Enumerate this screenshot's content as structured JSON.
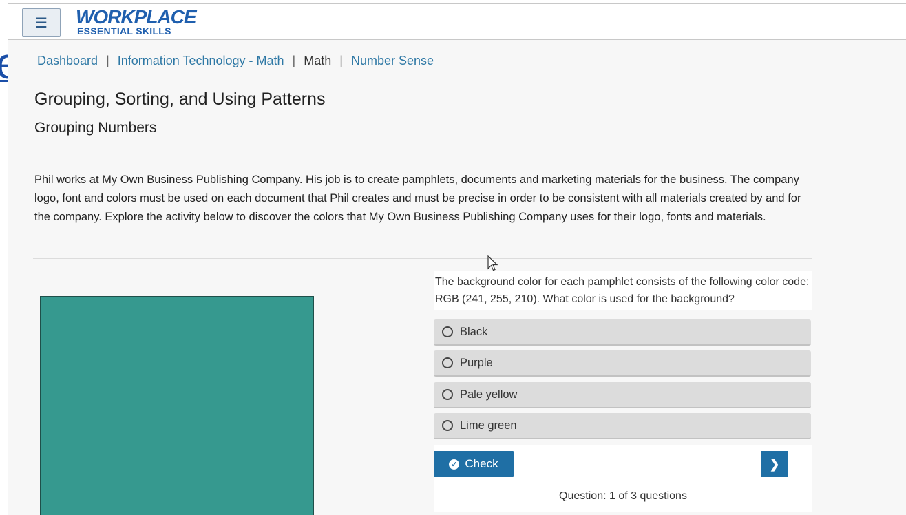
{
  "header": {
    "menu_icon": "hamburger-icon",
    "logo_line1": "WORKPLACE",
    "logo_line2": "ESSENTIAL SKILLS",
    "brand_color": "#1f5fae"
  },
  "edge_glyph": "e",
  "breadcrumb": [
    {
      "label": "Dashboard"
    },
    {
      "label": "Information Technology - Math"
    },
    {
      "label": "Math"
    },
    {
      "label": "Number Sense"
    }
  ],
  "page": {
    "title": "Grouping, Sorting, and Using Patterns",
    "subtitle": "Grouping Numbers",
    "intro": "Phil works at My Own Business Publishing Company. His job is to create pamphlets, documents and marketing materials for the business. The company logo, font and colors must be used on each document that Phil creates and must be precise in order to be consistent with all materials created by and for the company. Explore the activity below to discover the colors that My Own Business Publishing Company uses for their logo, fonts and materials."
  },
  "swatch": {
    "color": "#36998f"
  },
  "quiz": {
    "question": "The background color for each pamphlet consists of the following color code: RGB (241, 255, 210). What color is used for the background?",
    "options": [
      {
        "label": "Black"
      },
      {
        "label": "Purple"
      },
      {
        "label": "Pale yellow"
      },
      {
        "label": "Lime green"
      }
    ],
    "check_label": "Check",
    "check_icon": "check-circle-icon",
    "next_icon": "chevron-right-icon",
    "progress": "Question: 1 of 3 questions",
    "accent_color": "#1f6fa5"
  }
}
